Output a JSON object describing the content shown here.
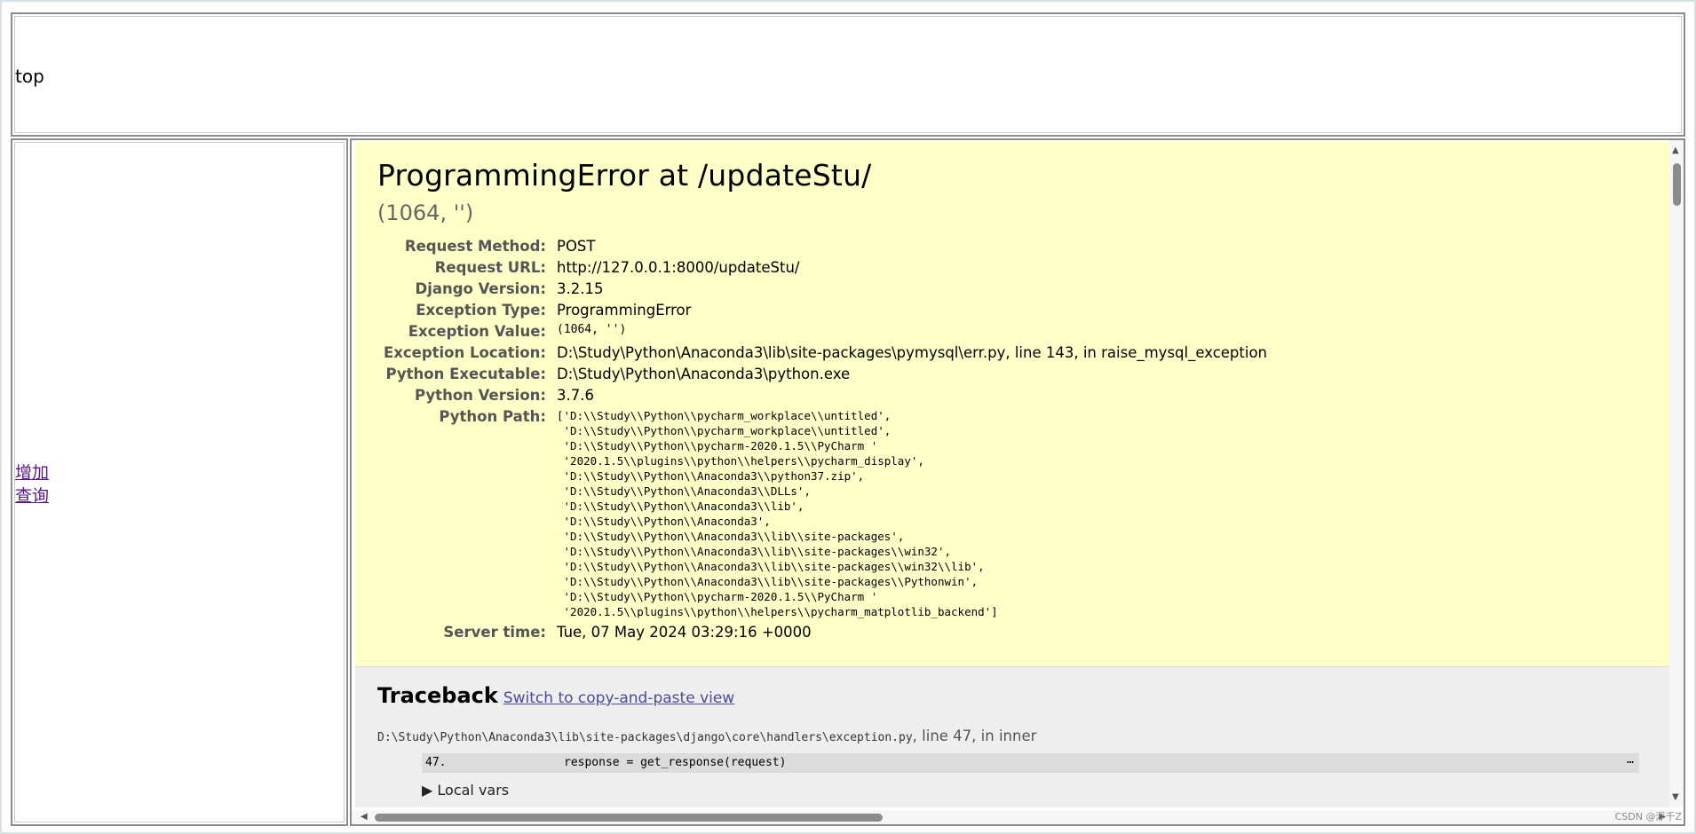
{
  "top_frame": {
    "text": "top"
  },
  "left_frame": {
    "links": [
      "增加",
      "查询"
    ]
  },
  "error": {
    "title": "ProgrammingError at /updateStu/",
    "subtitle": "(1064, '')",
    "meta": [
      {
        "label": "Request Method:",
        "value": "POST",
        "mono": false
      },
      {
        "label": "Request URL:",
        "value": "http://127.0.0.1:8000/updateStu/",
        "mono": false
      },
      {
        "label": "Django Version:",
        "value": "3.2.15",
        "mono": false
      },
      {
        "label": "Exception Type:",
        "value": "ProgrammingError",
        "mono": false
      },
      {
        "label": "Exception Value:",
        "value": "(1064, '')",
        "mono": true
      },
      {
        "label": "Exception Location:",
        "value": "D:\\Study\\Python\\Anaconda3\\lib\\site-packages\\pymysql\\err.py, line 143, in raise_mysql_exception",
        "mono": false
      },
      {
        "label": "Python Executable:",
        "value": "D:\\Study\\Python\\Anaconda3\\python.exe",
        "mono": false
      },
      {
        "label": "Python Version:",
        "value": "3.7.6",
        "mono": false
      }
    ],
    "python_path_label": "Python Path:",
    "python_path": [
      "['D:\\\\Study\\\\Python\\\\pycharm_workplace\\\\untitled',",
      " 'D:\\\\Study\\\\Python\\\\pycharm_workplace\\\\untitled',",
      " 'D:\\\\Study\\\\Python\\\\pycharm-2020.1.5\\\\PyCharm '",
      " '2020.1.5\\\\plugins\\\\python\\\\helpers\\\\pycharm_display',",
      " 'D:\\\\Study\\\\Python\\\\Anaconda3\\\\python37.zip',",
      " 'D:\\\\Study\\\\Python\\\\Anaconda3\\\\DLLs',",
      " 'D:\\\\Study\\\\Python\\\\Anaconda3\\\\lib',",
      " 'D:\\\\Study\\\\Python\\\\Anaconda3',",
      " 'D:\\\\Study\\\\Python\\\\Anaconda3\\\\lib\\\\site-packages',",
      " 'D:\\\\Study\\\\Python\\\\Anaconda3\\\\lib\\\\site-packages\\\\win32',",
      " 'D:\\\\Study\\\\Python\\\\Anaconda3\\\\lib\\\\site-packages\\\\win32\\\\lib',",
      " 'D:\\\\Study\\\\Python\\\\Anaconda3\\\\lib\\\\site-packages\\\\Pythonwin',",
      " 'D:\\\\Study\\\\Python\\\\pycharm-2020.1.5\\\\PyCharm '",
      " '2020.1.5\\\\plugins\\\\python\\\\helpers\\\\pycharm_matplotlib_backend']"
    ],
    "server_time_label": "Server time:",
    "server_time": "Tue, 07 May 2024 03:29:16 +0000"
  },
  "traceback": {
    "heading": "Traceback",
    "switch_link": "Switch to copy-and-paste view",
    "file": "D:\\Study\\Python\\Anaconda3\\lib\\site-packages\\django\\core\\handlers\\exception.py",
    "file_suffix": ", line 47, in inner",
    "line_no": "47.",
    "code": "response = get_response(request)",
    "dots": "…",
    "local_vars": "▶ Local vars"
  },
  "watermark": "CSDN @浮千Z"
}
